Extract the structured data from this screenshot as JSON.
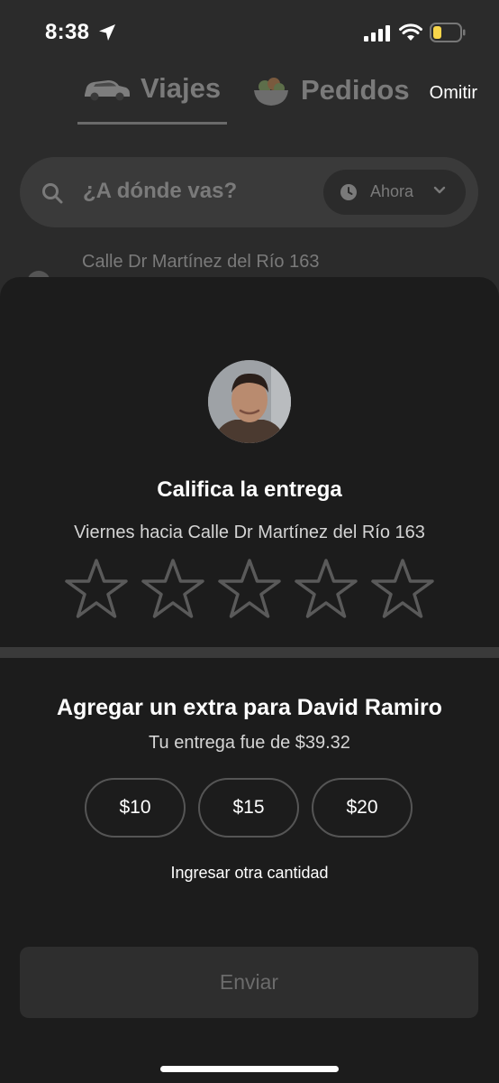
{
  "status_bar": {
    "time": "8:38",
    "icons": [
      "location-arrow-icon",
      "signal-icon",
      "wifi-icon",
      "battery-low-icon"
    ],
    "battery_color": "#f7d54a"
  },
  "background": {
    "tabs": [
      {
        "label": "Viajes",
        "icon": "car-icon",
        "selected": true
      },
      {
        "label": "Pedidos",
        "icon": "food-bowl-icon",
        "selected": false
      }
    ],
    "skip_label": "Omitir",
    "search": {
      "placeholder": "¿A dónde vas?",
      "when_label": "Ahora"
    },
    "recent_address": "Calle Dr Martínez del Río 163"
  },
  "rating_sheet": {
    "title": "Califica la entrega",
    "subtitle": "Viernes hacia Calle Dr Martínez del Río 163",
    "star_count": 5,
    "selected_stars": 0
  },
  "tip": {
    "title": "Agregar un extra para David Ramiro",
    "subtitle": "Tu entrega fue de $39.32",
    "options": [
      "$10",
      "$15",
      "$20"
    ],
    "other_amount_label": "Ingresar otra cantidad"
  },
  "submit_label": "Enviar",
  "colors": {
    "sheet": "#1c1c1c",
    "background": "#2b2b2b",
    "muted_text": "#7a7a7a",
    "disabled_text": "#6b6b6b"
  }
}
